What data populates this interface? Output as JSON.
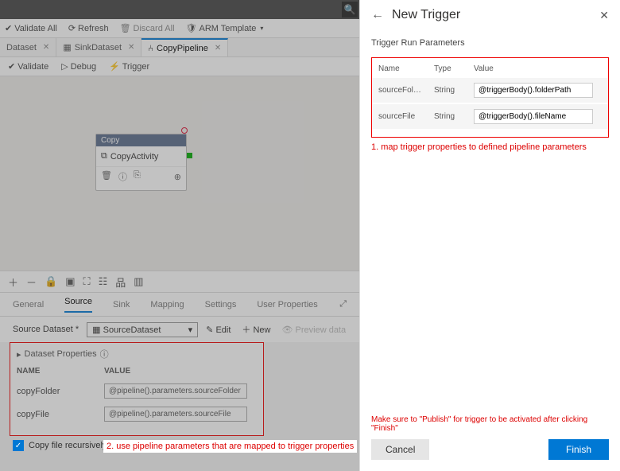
{
  "topbar": {
    "search_placeholder": "Search"
  },
  "toolbar": {
    "validate_all": "Validate All",
    "refresh": "Refresh",
    "discard_all": "Discard All",
    "arm_template": "ARM Template"
  },
  "tabs": [
    {
      "label": "Dataset"
    },
    {
      "label": "SinkDataset"
    },
    {
      "label": "CopyPipeline"
    }
  ],
  "canvas_toolbar": {
    "validate": "Validate",
    "debug": "Debug",
    "trigger": "Trigger"
  },
  "activity": {
    "category": "Copy",
    "name": "CopyActivity"
  },
  "prop_tabs": {
    "general": "General",
    "source": "Source",
    "sink": "Sink",
    "mapping": "Mapping",
    "settings": "Settings",
    "user_props": "User Properties"
  },
  "ds_row": {
    "label": "Source Dataset *",
    "selected": "SourceDataset",
    "edit": "Edit",
    "new": "New",
    "preview": "Preview data"
  },
  "ds_panel": {
    "title": "Dataset Properties",
    "col_name": "NAME",
    "col_value": "VALUE",
    "rows": [
      {
        "name": "copyFolder",
        "value": "@pipeline().parameters.sourceFolder"
      },
      {
        "name": "copyFile",
        "value": "@pipeline().parameters.sourceFile"
      }
    ]
  },
  "chk_row": {
    "label": "Copy file recursively"
  },
  "annotations": {
    "a1": "1. map trigger properties to defined pipeline parameters",
    "a2": "2. use pipeline parameters that are mapped to trigger properties"
  },
  "right_panel": {
    "title": "New Trigger",
    "section": "Trigger Run Parameters",
    "cols": {
      "name": "Name",
      "type": "Type",
      "value": "Value"
    },
    "rows": [
      {
        "name": "sourceFol…",
        "type": "String",
        "value": "@triggerBody().folderPath"
      },
      {
        "name": "sourceFile",
        "type": "String",
        "value": "@triggerBody().fileName"
      }
    ],
    "footer_note": "Make sure to \"Publish\" for trigger to be activated after clicking \"Finish\"",
    "cancel": "Cancel",
    "finish": "Finish"
  }
}
